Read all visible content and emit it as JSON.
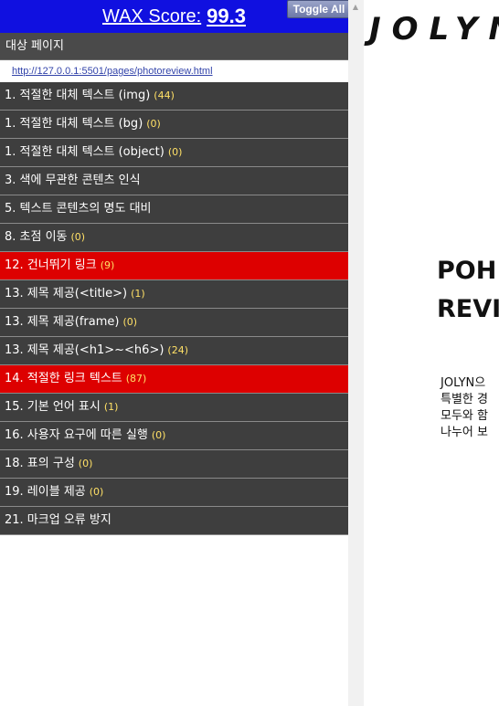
{
  "wax": {
    "score_label": "WAX Score:",
    "score_value": "99.3",
    "toggle_label": "Toggle All",
    "target_label": "대상 페이지",
    "target_url": "http://127.0.0.1:5501/pages/photoreview.html",
    "items": [
      {
        "label": "1. 적절한 대체 텍스트 (img)",
        "count": "(44)",
        "status": "ok"
      },
      {
        "label": "1. 적절한 대체 텍스트 (bg)",
        "count": "(0)",
        "status": "ok"
      },
      {
        "label": "1. 적절한 대체 텍스트 (object)",
        "count": "(0)",
        "status": "ok"
      },
      {
        "label": "3. 색에 무관한 콘텐츠 인식",
        "count": "",
        "status": "ok"
      },
      {
        "label": "5. 텍스트 콘텐츠의 명도 대비",
        "count": "",
        "status": "ok"
      },
      {
        "label": "8. 초점 이동",
        "count": "(0)",
        "status": "ok"
      },
      {
        "label": "12. 건너뛰기 링크",
        "count": "(9)",
        "status": "alert"
      },
      {
        "label": "13. 제목 제공(<title>)",
        "count": "(1)",
        "status": "ok"
      },
      {
        "label": "13. 제목 제공(frame)",
        "count": "(0)",
        "status": "ok"
      },
      {
        "label": "13. 제목 제공(<h1>~<h6>)",
        "count": "(24)",
        "status": "ok"
      },
      {
        "label": "14. 적절한 링크 텍스트",
        "count": "(87)",
        "status": "alert"
      },
      {
        "label": "15. 기본 언어 표시",
        "count": "(1)",
        "status": "ok"
      },
      {
        "label": "16. 사용자 요구에 따른 실행",
        "count": "(0)",
        "status": "ok"
      },
      {
        "label": "18. 표의 구성",
        "count": "(0)",
        "status": "ok"
      },
      {
        "label": "19. 레이블 제공",
        "count": "(0)",
        "status": "ok"
      },
      {
        "label": "21. 마크업 오류 방지",
        "count": "",
        "status": "ok"
      }
    ]
  },
  "page": {
    "logo": "JOLYN",
    "heading": "POH\nREVI",
    "intro": "JOLYN으\n특별한 경\n모두와 함\n나누어 보"
  },
  "colors": {
    "header_bg": "#1010e0",
    "item_bg": "#3e3e3e",
    "alert_bg": "#dd0000",
    "count_color": "#ffe066"
  }
}
